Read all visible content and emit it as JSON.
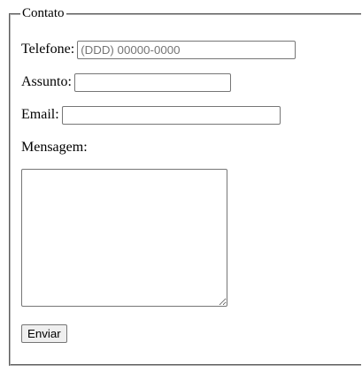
{
  "form": {
    "legend": "Contato",
    "phone": {
      "label": "Telefone:",
      "placeholder": "(DDD) 00000-0000",
      "value": ""
    },
    "subject": {
      "label": "Assunto:",
      "placeholder": "",
      "value": ""
    },
    "email": {
      "label": "Email:",
      "placeholder": "",
      "value": ""
    },
    "message": {
      "label": "Mensagem:",
      "value": ""
    },
    "submit_label": "Enviar"
  }
}
